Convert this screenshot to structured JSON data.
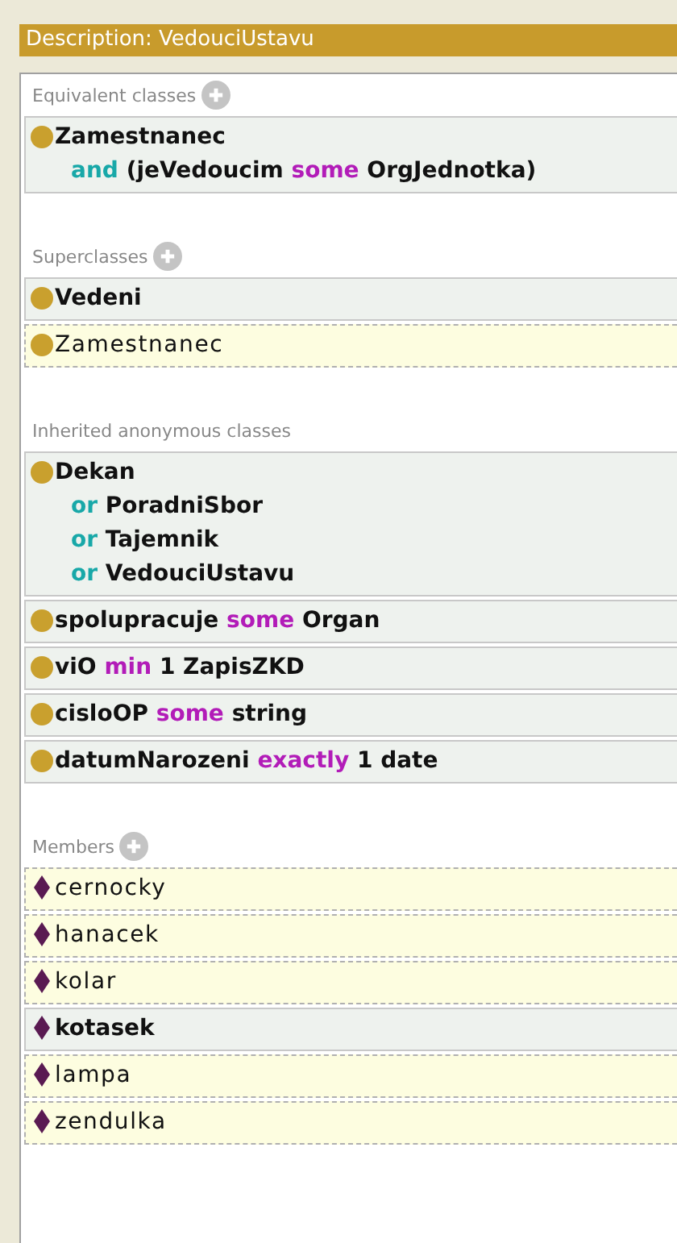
{
  "title": "Description: VedouciUstavu",
  "sections": [
    {
      "heading": "Equivalent classes",
      "addable": true,
      "kind": "class",
      "rows": [
        {
          "inferred": false,
          "lines": [
            [
              {
                "text": "Zamestnanec",
                "kind": "name"
              }
            ],
            [
              {
                "text": "and",
                "kind": "logical"
              },
              {
                "text": "(jeVedoucim",
                "kind": "name"
              },
              {
                "text": "some",
                "kind": "restriction"
              },
              {
                "text": "OrgJednotka)",
                "kind": "name"
              }
            ]
          ]
        }
      ]
    },
    {
      "heading": "Superclasses",
      "addable": true,
      "kind": "class",
      "rows": [
        {
          "inferred": false,
          "lines": [
            [
              {
                "text": "Vedeni",
                "kind": "name"
              }
            ]
          ]
        },
        {
          "inferred": true,
          "lines": [
            [
              {
                "text": "Zamestnanec",
                "kind": "name"
              }
            ]
          ]
        }
      ]
    },
    {
      "heading": "Inherited anonymous classes",
      "addable": false,
      "kind": "class",
      "rows": [
        {
          "inferred": false,
          "lines": [
            [
              {
                "text": "Dekan",
                "kind": "name"
              }
            ],
            [
              {
                "text": "or",
                "kind": "logical"
              },
              {
                "text": "PoradniSbor",
                "kind": "name"
              }
            ],
            [
              {
                "text": "or",
                "kind": "logical"
              },
              {
                "text": "Tajemnik",
                "kind": "name"
              }
            ],
            [
              {
                "text": "or",
                "kind": "logical"
              },
              {
                "text": "VedouciUstavu",
                "kind": "name"
              }
            ]
          ]
        },
        {
          "inferred": false,
          "lines": [
            [
              {
                "text": "spolupracuje",
                "kind": "name"
              },
              {
                "text": "some",
                "kind": "restriction"
              },
              {
                "text": "Organ",
                "kind": "name"
              }
            ]
          ]
        },
        {
          "inferred": false,
          "lines": [
            [
              {
                "text": "viO",
                "kind": "name"
              },
              {
                "text": "min",
                "kind": "restriction"
              },
              {
                "text": "1 ZapisZKD",
                "kind": "name"
              }
            ]
          ]
        },
        {
          "inferred": false,
          "lines": [
            [
              {
                "text": "cisloOP",
                "kind": "name"
              },
              {
                "text": "some",
                "kind": "restriction"
              },
              {
                "text": "string",
                "kind": "name"
              }
            ]
          ]
        },
        {
          "inferred": false,
          "lines": [
            [
              {
                "text": "datumNarozeni",
                "kind": "name"
              },
              {
                "text": "exactly",
                "kind": "restriction"
              },
              {
                "text": "1 date",
                "kind": "name"
              }
            ]
          ]
        }
      ]
    },
    {
      "heading": "Members",
      "addable": true,
      "kind": "individual",
      "rows": [
        {
          "inferred": true,
          "lines": [
            [
              {
                "text": "cernocky",
                "kind": "name"
              }
            ]
          ]
        },
        {
          "inferred": true,
          "lines": [
            [
              {
                "text": "hanacek",
                "kind": "name"
              }
            ]
          ]
        },
        {
          "inferred": true,
          "lines": [
            [
              {
                "text": "kolar",
                "kind": "name"
              }
            ]
          ]
        },
        {
          "inferred": false,
          "lines": [
            [
              {
                "text": "kotasek",
                "kind": "name"
              }
            ]
          ]
        },
        {
          "inferred": true,
          "lines": [
            [
              {
                "text": "lampa",
                "kind": "name"
              }
            ]
          ]
        },
        {
          "inferred": true,
          "lines": [
            [
              {
                "text": "zendulka",
                "kind": "name"
              }
            ]
          ]
        }
      ]
    }
  ]
}
